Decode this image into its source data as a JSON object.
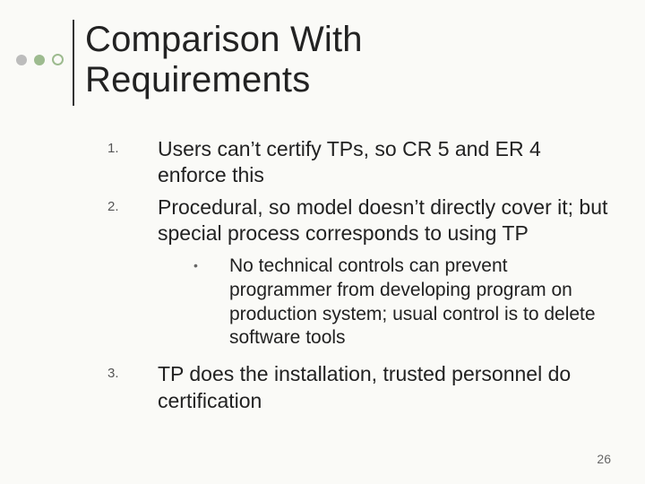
{
  "title_line1": "Comparison With",
  "title_line2": "Requirements",
  "items": [
    {
      "num": "1.",
      "text": "Users can’t certify TPs, so CR 5 and ER 4 enforce this"
    },
    {
      "num": "2.",
      "text": "Procedural, so model doesn’t directly cover it; but special process corresponds to using TP"
    }
  ],
  "subbullet": {
    "marker": "•",
    "text": "No technical controls can prevent programmer from developing program on production system; usual control is to delete software tools"
  },
  "item3": {
    "num": "3.",
    "text": "TP does the installation, trusted personnel do certification"
  },
  "page_number": "26"
}
